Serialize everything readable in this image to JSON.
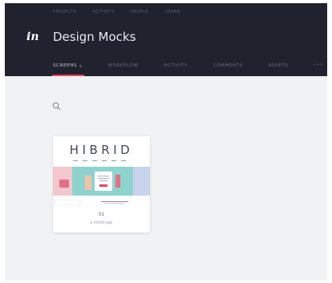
{
  "topnav": [
    "PROJECTS",
    "ACTIVITY",
    "PEOPLE",
    "LEARN"
  ],
  "logo": "in",
  "project_title": "Design Mocks",
  "tabs": [
    {
      "label": "SCREENS",
      "active": true
    },
    {
      "label": "WORKFLOW",
      "active": false
    },
    {
      "label": "ACTIVITY",
      "active": false
    },
    {
      "label": "COMMENTS",
      "active": false
    },
    {
      "label": "ASSETS",
      "active": false
    }
  ],
  "more_label": "•••",
  "screen_card": {
    "thumbnail_brand": "HIBRID",
    "number": "01",
    "date": "a month ago"
  },
  "colors": {
    "header_bg": "#20222e",
    "accent": "#e8435f",
    "canvas_bg": "#f1f2f4"
  }
}
